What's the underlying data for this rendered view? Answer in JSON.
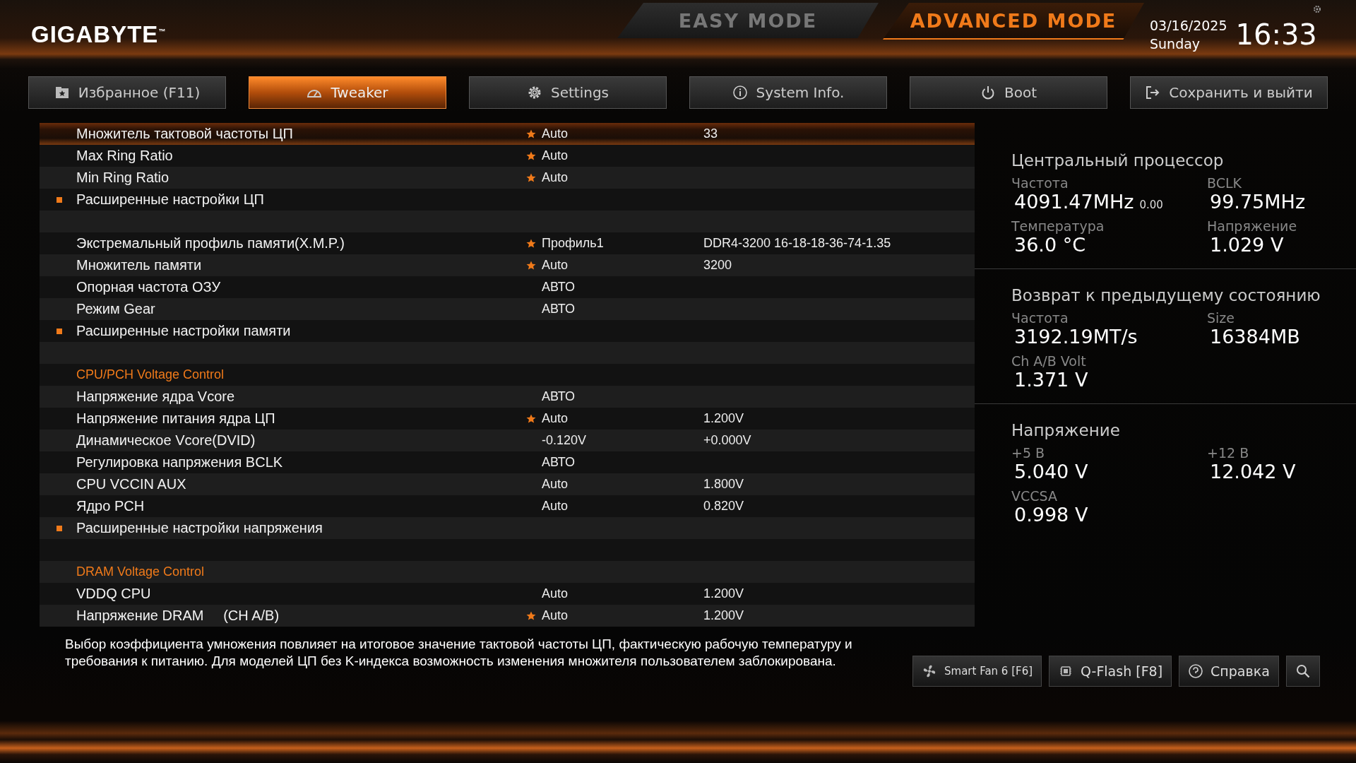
{
  "header": {
    "logo": "GIGABYTE$^{™}$",
    "modes": [
      {
        "label": "EASY MODE",
        "selected": false
      },
      {
        "label": "ADVANCED MODE",
        "selected": true
      }
    ],
    "date": "03/16/2025",
    "day": "Sunday",
    "time": "16:33"
  },
  "tabs": [
    {
      "label": "Избранное (F11)",
      "selected": false
    },
    {
      "label": "Tweaker",
      "selected": true
    },
    {
      "label": "Settings",
      "selected": false
    },
    {
      "label": "System Info.",
      "selected": false
    },
    {
      "label": "Boot",
      "selected": false
    },
    {
      "label": "Сохранить и выйти",
      "selected": false
    }
  ],
  "settings": [
    {
      "kind": "setting",
      "label": "Множитель тактовой частоты ЦП",
      "starred": true,
      "value": "Auto",
      "value_2": "33",
      "selected": true
    },
    {
      "kind": "setting",
      "label": "Max Ring Ratio",
      "starred": true,
      "value": "Auto",
      "selected": false
    },
    {
      "kind": "setting",
      "label": "Min Ring Ratio",
      "starred": true,
      "value": "Auto",
      "selected": false
    },
    {
      "kind": "submenu",
      "label": "Расширенные настройки ЦП",
      "selected": false
    },
    {
      "kind": "blank"
    },
    {
      "kind": "setting",
      "label": "Экстремальный профиль памяти(X.M.P.)",
      "starred": true,
      "value": "Профиль1",
      "value_2": "DDR4-3200 16-18-18-36-74-1.35",
      "selected": false
    },
    {
      "kind": "setting",
      "label": "Множитель памяти",
      "starred": true,
      "value": "Auto",
      "value_2": "3200",
      "selected": false
    },
    {
      "kind": "setting",
      "label": "Опорная частота ОЗУ",
      "starred": false,
      "value": "АВТО",
      "selected": false
    },
    {
      "kind": "setting",
      "label": "Режим Gear",
      "starred": false,
      "value": "АВТО",
      "selected": false
    },
    {
      "kind": "submenu",
      "label": "Расширенные настройки памяти",
      "selected": false
    },
    {
      "kind": "blank"
    },
    {
      "kind": "section",
      "label": "CPU/PCH Voltage Control"
    },
    {
      "kind": "setting",
      "label": "Напряжение ядра Vcore",
      "starred": false,
      "value": "АВТО",
      "selected": false
    },
    {
      "kind": "setting",
      "label": "Напряжение питания ядра ЦП",
      "starred": true,
      "value": "Auto",
      "value_2": "1.200V",
      "selected": false
    },
    {
      "kind": "setting",
      "label": "Динамическое Vcore(DVID)",
      "starred": false,
      "value": "-0.120V",
      "value_2": "+0.000V",
      "selected": false
    },
    {
      "kind": "setting",
      "label": "Регулировка напряжения BCLK",
      "starred": false,
      "value": "АВТО",
      "selected": false
    },
    {
      "kind": "setting",
      "label": "CPU VCCIN AUX",
      "starred": false,
      "value": "Auto",
      "value_2": "1.800V",
      "selected": false
    },
    {
      "kind": "setting",
      "label": "Ядро PCH",
      "starred": false,
      "value": "Auto",
      "value_2": "0.820V",
      "selected": false
    },
    {
      "kind": "submenu",
      "label": "Расширенные настройки напряжения",
      "selected": false
    },
    {
      "kind": "blank"
    },
    {
      "kind": "section",
      "label": "DRAM Voltage Control"
    },
    {
      "kind": "setting",
      "label": "VDDQ CPU",
      "starred": false,
      "value": "Auto",
      "value_2": "1.200V",
      "selected": false
    },
    {
      "kind": "setting",
      "label": "Напряжение DRAM     (CH A/B)",
      "starred": true,
      "value": "Auto",
      "value_2": "1.200V",
      "selected": false
    }
  ],
  "monitor": [
    {
      "title": "Центральный процессор",
      "items": [
        {
          "label": "Частота",
          "value": "4091.47MHz",
          "note": "0.00"
        },
        {
          "label": "BCLK",
          "value": "99.75MHz"
        },
        {
          "label": "Температура",
          "value": "36.0 °C"
        },
        {
          "label": "Напряжение",
          "value": "1.029 V"
        }
      ]
    },
    {
      "title": "Возврат к предыдущему состоянию",
      "items": [
        {
          "label": "Частота",
          "value": "3192.19MT/s"
        },
        {
          "label": "Size",
          "value": "16384MB"
        },
        {
          "label": "Ch A/B Volt",
          "value": "1.371 V"
        }
      ]
    },
    {
      "title": "Напряжение",
      "items": [
        {
          "label": "+5 В",
          "value": "5.040 V"
        },
        {
          "label": "+12 В",
          "value": "12.042 V"
        },
        {
          "label": "VCCSA",
          "value": "0.998 V"
        }
      ]
    }
  ],
  "help_text": "Выбор коэффициента умножения повлияет на итоговое значение тактовой частоты ЦП, фактическую рабочую температуру и требования к питанию. Для моделей ЦП без K-индекса возможность изменения множителя пользователем заблокирована.",
  "footer_buttons": [
    {
      "kind": "button",
      "label": "Smart Fan 6 [F6]"
    },
    {
      "kind": "button",
      "label": "Q-Flash [F8]"
    },
    {
      "kind": "button",
      "label": "Справка"
    },
    {
      "kind": "search"
    }
  ]
}
